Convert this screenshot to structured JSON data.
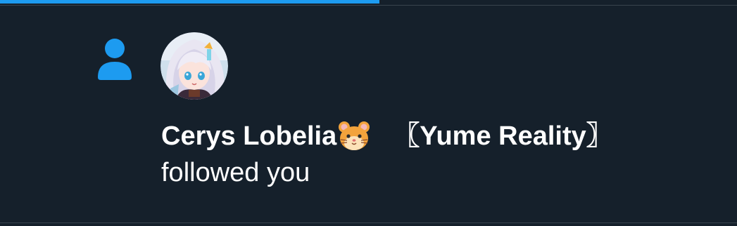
{
  "progress": {
    "fraction": 0.515,
    "color": "#1d9bf0"
  },
  "notification": {
    "type_icon": "person-icon",
    "accent_color": "#1d9bf0",
    "avatar_icon": "anime-avatar-image",
    "user": {
      "name": "Cerys Lobelia",
      "name_emoji": "hamster-face-icon",
      "affiliation": "〖Yume Reality〗"
    },
    "action_text": "followed you"
  },
  "colors": {
    "background": "#15202b",
    "divider": "#38444d",
    "text": "#ffffff"
  }
}
